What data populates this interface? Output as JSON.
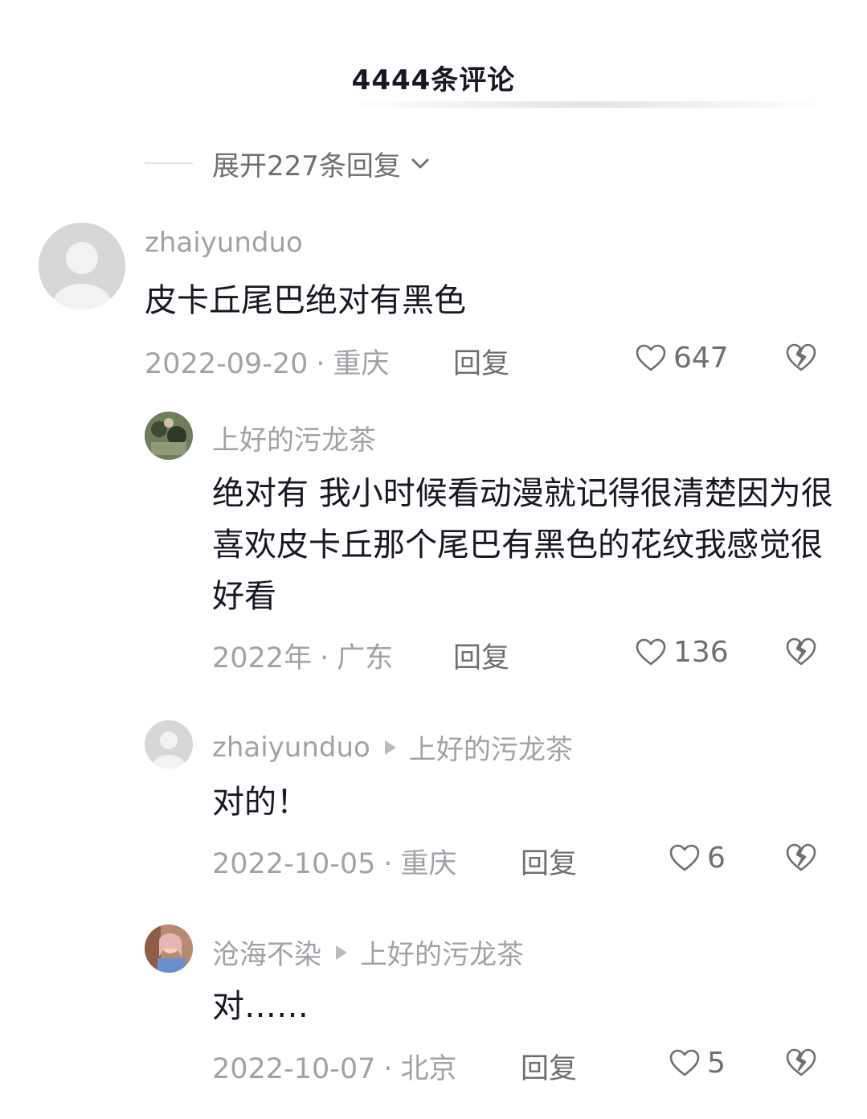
{
  "header": {
    "title": "4444条评论"
  },
  "expand_replies": {
    "label": "展开227条回复"
  },
  "comments": [
    {
      "username": "zhaiyunduo",
      "text": "皮卡丘尾巴绝对有黑色",
      "date": "2022-09-20",
      "location": "重庆",
      "reply_label": "回复",
      "likes": "647"
    },
    {
      "username": "上好的污龙茶",
      "text": "绝对有 我小时候看动漫就记得很清楚因为很喜欢皮卡丘那个尾巴有黑色的花纹我感觉很好看",
      "date": "2022年",
      "location": "广东",
      "reply_label": "回复",
      "likes": "136"
    },
    {
      "username": "zhaiyunduo",
      "reply_to": "上好的污龙茶",
      "text": "对的！",
      "date": "2022-10-05",
      "location": "重庆",
      "reply_label": "回复",
      "likes": "6"
    },
    {
      "username": "沧海不染",
      "reply_to": "上好的污龙茶",
      "text": "对……",
      "date": "2022-10-07",
      "location": "北京",
      "reply_label": "回复",
      "likes": "5"
    }
  ],
  "meta_separator": "·"
}
